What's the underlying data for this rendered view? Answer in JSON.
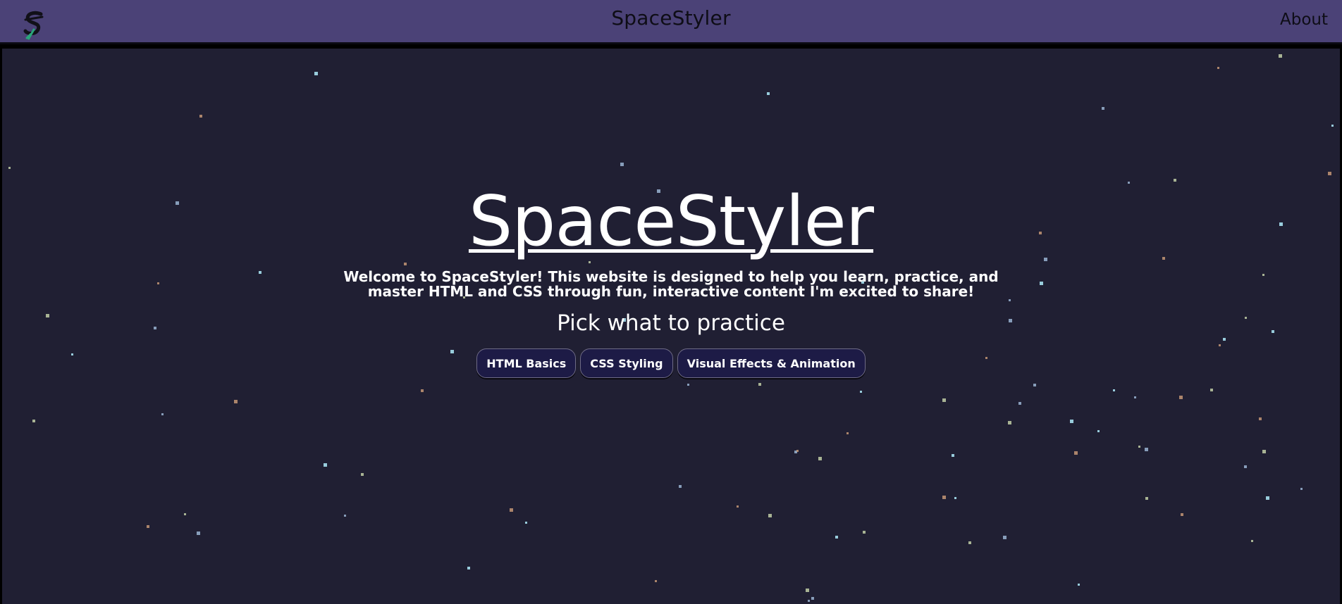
{
  "header": {
    "site_name": "SpaceStyler",
    "about_label": "About"
  },
  "hero": {
    "title": "SpaceStyler",
    "welcome_text": "Welcome to SpaceStyler! This website is designed to help you learn, practice, and master HTML and CSS through fun, interactive content I'm excited to share!",
    "pick_heading": "Pick what to practice",
    "buttons": [
      {
        "label": "HTML Basics"
      },
      {
        "label": "CSS Styling"
      },
      {
        "label": "Visual Effects & Animation"
      }
    ]
  },
  "colors": {
    "header_bg": "#4b4277",
    "stage_bg": "#201f33",
    "button_bg": "#1d1b46",
    "star_colors": [
      "#9fd6e6",
      "#d9a77f",
      "#d6e6b6",
      "#a9c8e8"
    ]
  }
}
